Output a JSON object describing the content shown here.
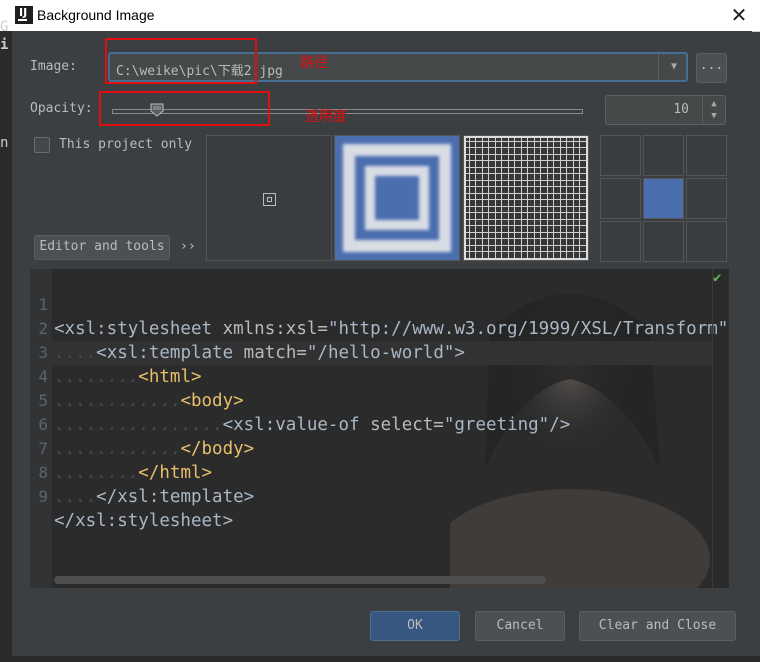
{
  "window": {
    "title": "Background Image",
    "icon": "intellij-idea-icon",
    "close_glyph": "✕"
  },
  "form": {
    "image_label": "Image:",
    "image_path": "C:\\weike\\pic\\下载2.jpg",
    "browse_label": "...",
    "opacity_label": "Opacity:",
    "opacity_value": "10",
    "project_only_label": "This project only"
  },
  "preview": {
    "tab_label": "Editor and tools",
    "more_label": "››",
    "lines": [
      {
        "n": "1"
      },
      {
        "n": "2"
      },
      {
        "n": "3"
      },
      {
        "n": "4"
      },
      {
        "n": "5"
      },
      {
        "n": "6"
      },
      {
        "n": "7"
      },
      {
        "n": "8"
      },
      {
        "n": "9"
      }
    ],
    "code": {
      "l1_tag": "<xsl:stylesheet ",
      "l1_attr": "xmlns:xsl=",
      "l1_val": "\"http://www.w3.org/1999/XSL/Transform\"",
      "l2_tag": "<xsl:template ",
      "l2_attr": "match=",
      "l2_val": "\"/hello-world\"",
      "l2_end": ">",
      "l3": "<html>",
      "l4": "<body>",
      "l5_tag": "<xsl:value-of ",
      "l5_attr": "select=",
      "l5_val": "\"greeting\"",
      "l5_end": "/>",
      "l6": "</body>",
      "l7": "</html>",
      "l8": "</xsl:template>",
      "l9": "</xsl:stylesheet>"
    }
  },
  "buttons": {
    "ok": "OK",
    "cancel": "Cancel",
    "clear_close": "Clear and Close"
  },
  "annotations": {
    "path_note": "路径",
    "opacity_note": "透明度"
  },
  "colors": {
    "accent": "#4b6eaf",
    "annotation": "#e01010",
    "ok_button": "#365880"
  }
}
